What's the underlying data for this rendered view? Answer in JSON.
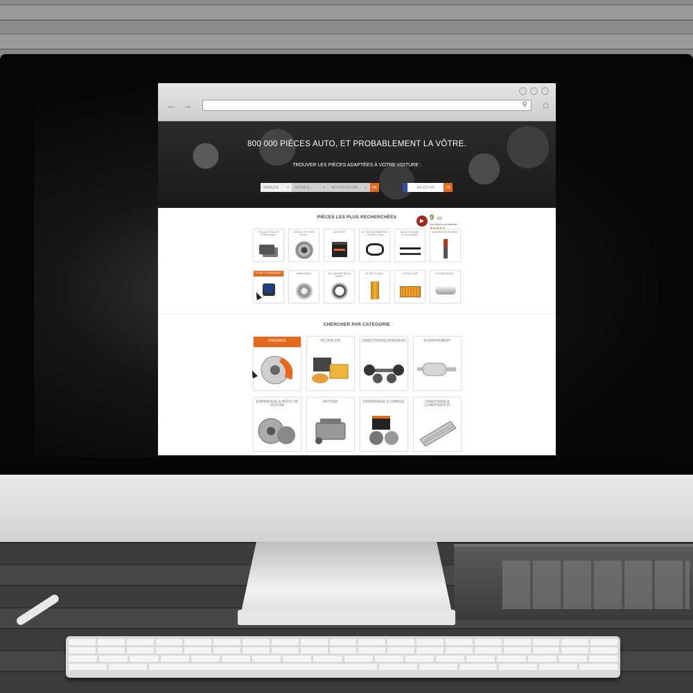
{
  "browser": {
    "url": "",
    "nav": {
      "back": "←",
      "forward": "→"
    }
  },
  "hero": {
    "title": "800 000 PIÈCES AUTO, ET PROBABLEMENT LA VÔTRE.",
    "subtitle": "TROUVER LES PIÈCES ADAPTÉES À VOTRE VOITURE :",
    "selects": [
      "MARQUE",
      "MODÈLE",
      "MOTORISATION"
    ],
    "ok_label": "OK",
    "plate_placeholder": "AA-123-AA",
    "plate_ok_label": "OK"
  },
  "popular": {
    "title": "PIÈCES LES PLUS RECHERCHÉES",
    "items": [
      {
        "label": "PLAQUETTES DE FREIN AVANT",
        "icon": "brake-pads-icon"
      },
      {
        "label": "DISQUE DE FREIN AVANT",
        "icon": "brake-disc-icon"
      },
      {
        "label": "BATTERIE",
        "icon": "battery-icon"
      },
      {
        "label": "KIT DE DISTRIBUTION + POMPE À EAU",
        "icon": "timing-belt-icon"
      },
      {
        "label": "BALAI D'ESSUIE-GLACE AVANT",
        "icon": "wiper-icon"
      },
      {
        "label": "AMORTISSEUR AVANT",
        "icon": "shock-absorber-icon"
      },
      {
        "label": "FILTRE À CARBURANT",
        "icon": "fuel-filter-icon"
      },
      {
        "label": "EMBRAYAGE",
        "icon": "clutch-icon"
      },
      {
        "label": "ROULEMENT ROUE AVANT",
        "icon": "wheel-bearing-icon"
      },
      {
        "label": "FILTRE À HUILE",
        "icon": "oil-filter-icon"
      },
      {
        "label": "FILTRE À AIR",
        "icon": "air-filter-icon"
      },
      {
        "label": "ÉCHAPPEMENT",
        "icon": "exhaust-icon"
      }
    ]
  },
  "rating": {
    "score": "9",
    "scale": "/10",
    "text": "Nos clients sont satisfaits",
    "stars": "★★★★★"
  },
  "categories": {
    "title": "CHERCHER PAR CATÉGORIE",
    "items": [
      {
        "label": "FREINAGE",
        "icon": "brake-icon"
      },
      {
        "label": "FILTRATION",
        "icon": "filtration-icon"
      },
      {
        "label": "DIRECTION/SUSPENSION",
        "icon": "suspension-icon"
      },
      {
        "label": "ÉCHAPPEMENT",
        "icon": "exhaust-icon"
      },
      {
        "label": "EMBRAYAGE & BOÎTE DE VITESSE",
        "icon": "gearbox-icon"
      },
      {
        "label": "MOTEUR",
        "icon": "engine-icon"
      },
      {
        "label": "DÉMARRAGE & CHARGE",
        "icon": "starter-icon"
      },
      {
        "label": "CHAUFFAGE & CLIMATISATION",
        "icon": "radiator-icon"
      }
    ]
  },
  "colors": {
    "accent": "#e4691d",
    "rating_green": "#4a8a1f",
    "rating_badge": "#a3281c"
  }
}
